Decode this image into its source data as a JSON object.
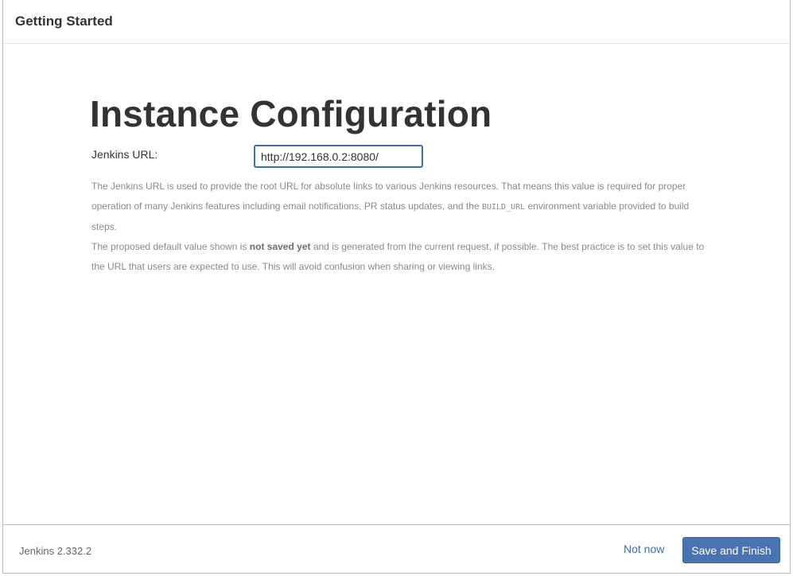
{
  "header": {
    "title": "Getting Started"
  },
  "main": {
    "heading": "Instance Configuration",
    "url_label": "Jenkins URL:",
    "url_value": "http://192.168.0.2:8080/",
    "help": {
      "p1_part1": "The Jenkins URL is used to provide the root URL for absolute links to various Jenkins resources. That means this value is required for proper operation of many Jenkins features including email notifications, PR status updates, and the ",
      "p1_code": "BUILD_URL",
      "p1_part2": " environment variable provided to build steps.",
      "p2_part1": "The proposed default value shown is ",
      "p2_bold": "not saved yet",
      "p2_part2": " and is generated from the current request, if possible. The best practice is to set this value to the URL that users are expected to use. This will avoid confusion when sharing or viewing links."
    }
  },
  "footer": {
    "version": "Jenkins 2.332.2",
    "not_now_label": "Not now",
    "save_label": "Save and Finish"
  },
  "colors": {
    "primary_button": "#4a73b1",
    "link": "#3a6fb3",
    "input_focus_border": "#3a6fb3",
    "help_text": "#8a8a8a"
  }
}
